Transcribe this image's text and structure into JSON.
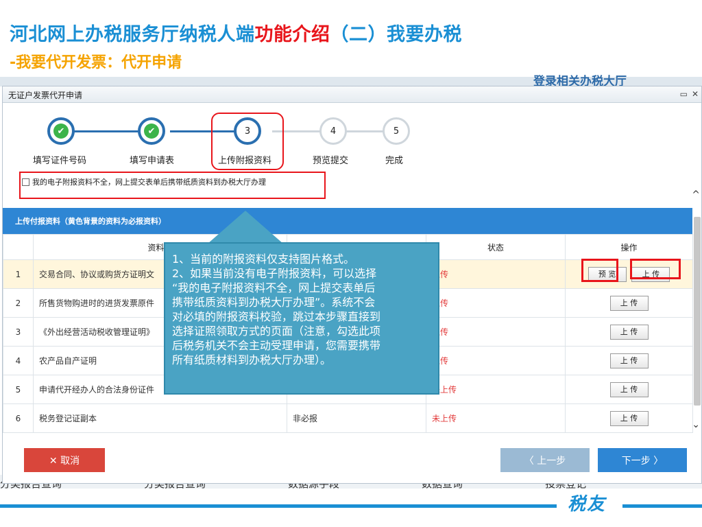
{
  "slide": {
    "title_blue_1": "河北网上办税服务厅纳税人端",
    "title_red": "功能介绍",
    "title_blue_2": "（二）我要办税",
    "subtitle": "-我要代开发票：代开申请",
    "brand": "税友",
    "bg_top_text": "登录相关办税大厅",
    "bg_bottom": [
      "分类报告查询",
      "分类报告查询",
      "数据源手段",
      "数据查询",
      "投票登记"
    ]
  },
  "dialog": {
    "title": "无证户发票代开申请",
    "win_restore": "▭",
    "win_close": "✕",
    "steps": [
      {
        "label": "填写证件号码",
        "state": "done",
        "symbol": "✔"
      },
      {
        "label": "填写申请表",
        "state": "done",
        "symbol": "✔"
      },
      {
        "label": "上传附报资料",
        "state": "current",
        "symbol": "3"
      },
      {
        "label": "预览提交",
        "state": "future",
        "symbol": "4"
      },
      {
        "label": "完成",
        "state": "future",
        "symbol": "5"
      }
    ],
    "checkbox_label": "我的电子附报资料不全，网上提交表单后携带纸质资料到办税大厅办理",
    "section_title": "上传付报资料（黄色背景的资料为必报资料）",
    "columns": [
      "",
      "资料名",
      "",
      "状态",
      "操作"
    ],
    "rows": [
      {
        "num": "1",
        "name": "交易合同、协议或购货方证明文",
        "required": "",
        "status": "上传",
        "ops": [
          "预 览",
          "上 传"
        ]
      },
      {
        "num": "2",
        "name": "所售货物购进时的进货发票原件",
        "required": "",
        "status": "上传",
        "ops": [
          "上 传"
        ]
      },
      {
        "num": "3",
        "name": "《外出经营活动税收管理证明》",
        "required": "",
        "status": "上传",
        "ops": [
          "上 传"
        ]
      },
      {
        "num": "4",
        "name": "农产品自产证明",
        "required": "",
        "status": "上传",
        "ops": [
          "上 传"
        ]
      },
      {
        "num": "5",
        "name": "申请代开经办人的合法身份证件",
        "required": "非必报",
        "status": "未上传",
        "ops": [
          "上 传"
        ]
      },
      {
        "num": "6",
        "name": "税务登记证副本",
        "required": "非必报",
        "status": "未上传",
        "ops": [
          "上 传"
        ]
      }
    ],
    "cancel_label": "✕ 取消",
    "prev_label": "〈 上一步",
    "next_label": "下一步 〉"
  },
  "callout": {
    "lines": [
      "1、当前的附报资料仅支持图片格式。",
      "2、如果当前没有电子附报资料，可以选择",
      "“我的电子附报资料不全，网上提交表单后",
      "携带纸质资料到办税大厅办理”。系统不会",
      "对必填的附报资料校验，跳过本步骤直接到",
      "选择证照领取方式的页面（注意，勾选此项",
      "后税务机关不会主动受理申请，您需要携带",
      "所有纸质材料到办税大厅办理）。"
    ]
  },
  "colors": {
    "title_blue": "#1a8fd4",
    "title_red": "#e8151b",
    "subtitle_orange": "#f5a300",
    "table_header_blue": "#2e86d4",
    "callout_bg": "#4aa3c4",
    "highlight_red": "#e8151b"
  }
}
